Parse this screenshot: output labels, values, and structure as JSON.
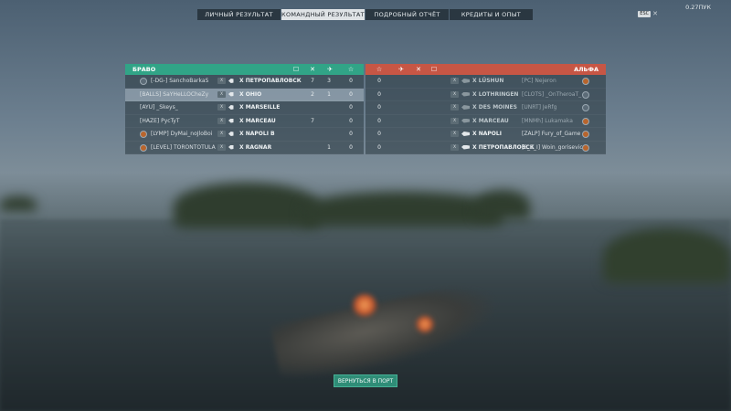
{
  "tabs": [
    {
      "label": "ЛИЧНЫЙ РЕЗУЛЬТАТ",
      "active": false
    },
    {
      "label": "КОМАНДНЫЙ РЕЗУЛЬТАТ",
      "active": true
    },
    {
      "label": "ПОДРОБНЫЙ ОТЧЁТ",
      "active": false
    },
    {
      "label": "КРЕДИТЫ И ОПЫТ",
      "active": false
    }
  ],
  "top_right": {
    "credits": "0.27ПУК",
    "key_label": "ESC"
  },
  "left_team": {
    "name": "БРАВО",
    "accent": "#31a487",
    "rows": [
      {
        "player": "[-DG-] SanchoBarkaS",
        "tier": "X",
        "ship": "X ПЕТРОПАВЛОВСК",
        "v1": "7",
        "v2": "3",
        "v3": "0"
      },
      {
        "player": "[BALLS] SaYHeLLOCheZy",
        "tier": "X",
        "ship": "X OHIO",
        "v1": "2",
        "v2": "1",
        "v3": "0"
      },
      {
        "player": "[AYU] _Skeys_",
        "tier": "X",
        "ship": "X MARSEILLE",
        "v1": "",
        "v2": "",
        "v3": "0"
      },
      {
        "player": "[HAZE] PycTyT",
        "tier": "X",
        "ship": "X MARCEAU",
        "v1": "7",
        "v2": "",
        "v3": "0"
      },
      {
        "player": "[LYMP] DyMai_noJloBoi",
        "tier": "X",
        "ship": "X NAPOLI B",
        "v1": "",
        "v2": "",
        "v3": "0"
      },
      {
        "player": "[LEVEL] TORONTOTULA",
        "tier": "X",
        "ship": "X RAGNAR",
        "v1": "",
        "v2": "1",
        "v3": "0"
      }
    ]
  },
  "right_team": {
    "name": "АЛЬФА",
    "accent": "#c75645",
    "rows": [
      {
        "score": "0",
        "tier": "X",
        "ship": "X LÜSHUN",
        "player": "[PC] Nejeron"
      },
      {
        "score": "0",
        "tier": "X",
        "ship": "X LOTHRINGEN",
        "player": "[CLOTS] _OnTheroaT_"
      },
      {
        "score": "0",
        "tier": "X",
        "ship": "X DES MOINES",
        "player": "[UNRT] JeRfg"
      },
      {
        "score": "0",
        "tier": "X",
        "ship": "X MARCEAU",
        "player": "[MNMh] Lukamaka"
      },
      {
        "score": "0",
        "tier": "X",
        "ship": "X NAPOLI",
        "player": "[ZALP] Fury_of_Game"
      },
      {
        "score": "0",
        "tier": "X",
        "ship": "X ПЕТРОПАВЛОВСК",
        "player": "[S_E_I] Woin_gorisevic"
      }
    ]
  },
  "footer": {
    "return_button": "ВЕРНУТЬСЯ В ПОРТ"
  }
}
